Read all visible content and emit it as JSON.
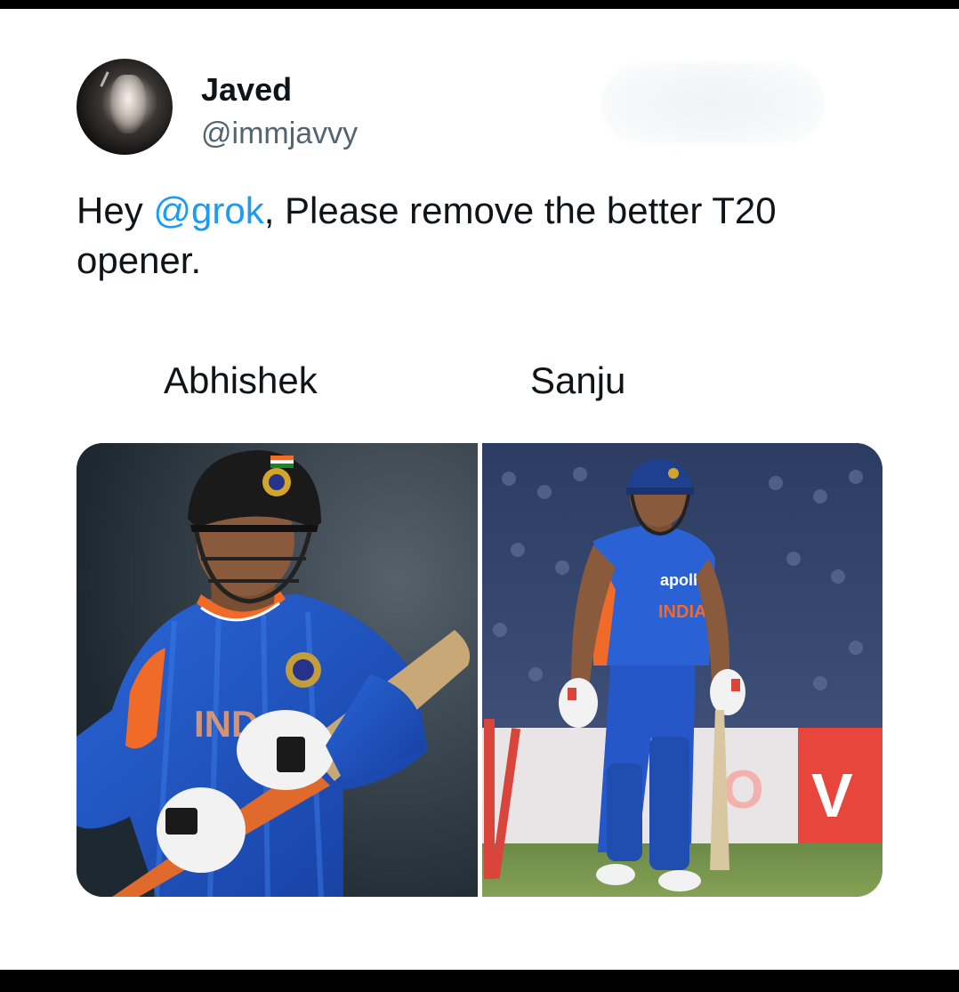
{
  "user": {
    "display_name": "Javed",
    "handle": "@immjavvy"
  },
  "tweet": {
    "text_before": "Hey ",
    "mention": "@grok",
    "text_after": ", Please remove the better T20 opener."
  },
  "media": {
    "left_label": "Abhishek",
    "right_label": "Sanju"
  },
  "colors": {
    "mention": "#1d9bf0",
    "text": "#0f1419",
    "handle": "#536471",
    "jersey_blue": "#1f4fc4",
    "jersey_orange": "#f06a28"
  }
}
